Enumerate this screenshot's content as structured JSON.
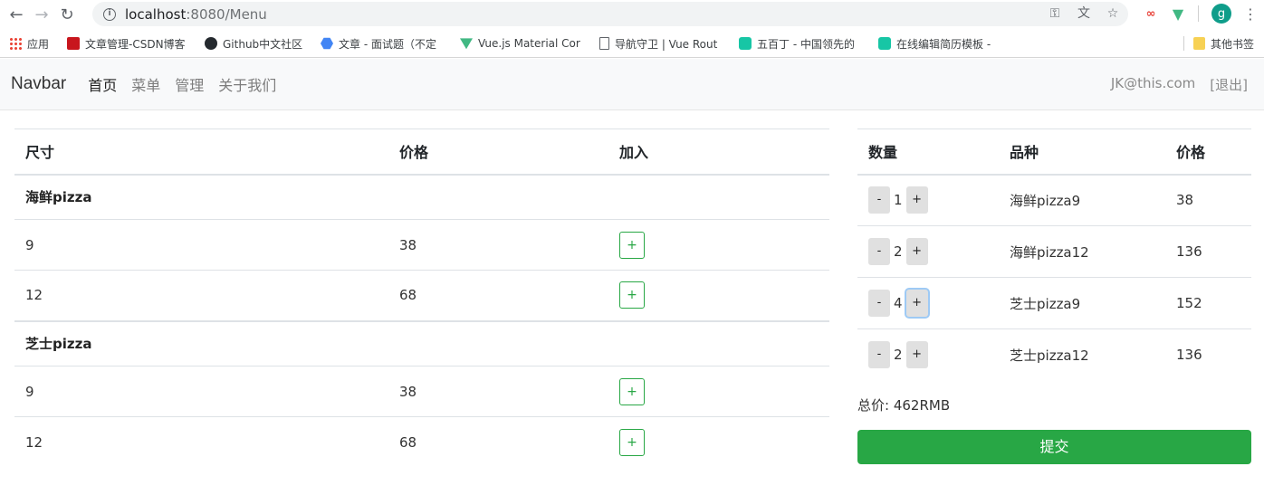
{
  "browser": {
    "url_host": "localhost",
    "url_rest": ":8080/Menu",
    "avatar_letter": "g",
    "bookmarks": [
      {
        "label": "应用",
        "icon": "apps-icon"
      },
      {
        "label": "文章管理-CSDN博客",
        "icon": "csdn-icon"
      },
      {
        "label": "Github中文社区",
        "icon": "github-icon"
      },
      {
        "label": "文章 - 面试题（不定",
        "icon": "hexagon-icon"
      },
      {
        "label": "Vue.js Material Cor",
        "icon": "vue-icon"
      },
      {
        "label": "导航守卫 | Vue Rout",
        "icon": "document-icon"
      },
      {
        "label": "五百丁 - 中国领先的",
        "icon": "s-icon"
      },
      {
        "label": "在线编辑简历模板 -",
        "icon": "s-icon"
      },
      {
        "label": "其他书签",
        "icon": "folder-icon"
      }
    ]
  },
  "navbar": {
    "brand": "Navbar",
    "links": [
      "首页",
      "菜单",
      "管理",
      "关于我们"
    ],
    "user": "JK@this.com",
    "logout": "[退出]"
  },
  "menu": {
    "headers": [
      "尺寸",
      "价格",
      "加入"
    ],
    "add_label": "+",
    "groups": [
      {
        "name": "海鲜pizza",
        "items": [
          {
            "size": "9",
            "price": "38"
          },
          {
            "size": "12",
            "price": "68"
          }
        ]
      },
      {
        "name": "芝士pizza",
        "items": [
          {
            "size": "9",
            "price": "38"
          },
          {
            "size": "12",
            "price": "68"
          }
        ]
      }
    ]
  },
  "cart": {
    "headers": [
      "数量",
      "品种",
      "价格"
    ],
    "minus_label": "-",
    "plus_label": "+",
    "items": [
      {
        "qty": "1",
        "name": "海鲜pizza9",
        "price": "38"
      },
      {
        "qty": "2",
        "name": "海鲜pizza12",
        "price": "136"
      },
      {
        "qty": "4",
        "name": "芝士pizza9",
        "price": "152"
      },
      {
        "qty": "2",
        "name": "芝士pizza12",
        "price": "136"
      }
    ],
    "total": "总价: 462RMB",
    "submit": "提交"
  },
  "colors": {
    "submit": "#28a745",
    "add_border": "#28a745",
    "navbar_bg": "#f8f9fa"
  }
}
